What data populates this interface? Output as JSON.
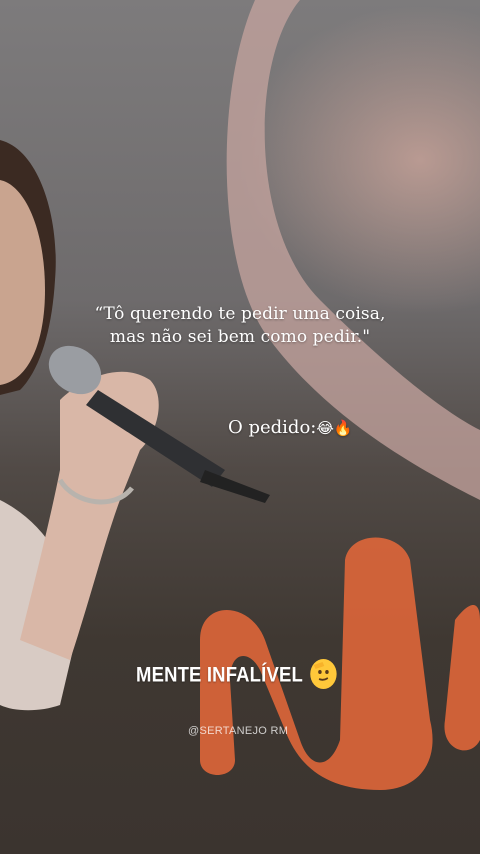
{
  "quote": {
    "line1": "“Tô querendo te pedir uma coisa,",
    "line2": "mas não sei bem como pedir.\""
  },
  "request": {
    "text": "O pedido:",
    "emojis": "😂🔥"
  },
  "title": {
    "text": "MENTE INFALÍVEL",
    "emoji_icon": "saluting-face-icon"
  },
  "watermark": "@SERTANEJO RM"
}
